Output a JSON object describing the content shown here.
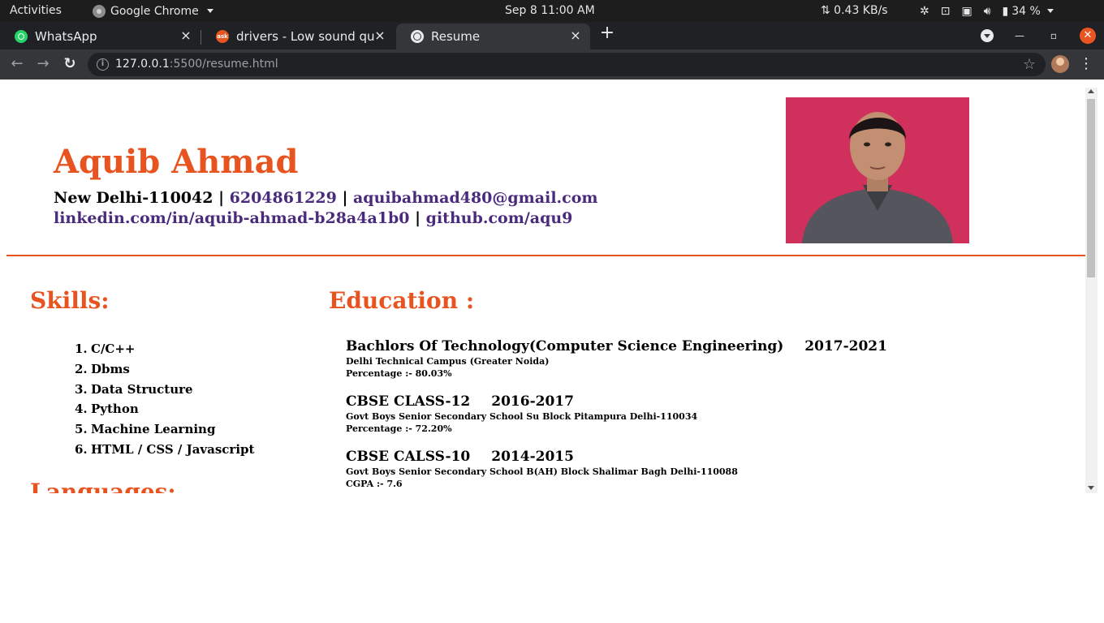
{
  "system_bar": {
    "activities": "Activities",
    "app_name": "Google Chrome",
    "clock": "Sep 8  11:00 AM",
    "net_speed": "⇅ 0.43 KB/s",
    "battery": "34 %"
  },
  "tabs": [
    {
      "title": "WhatsApp",
      "close": "×"
    },
    {
      "title": "drivers - Low sound qu",
      "close": "×"
    },
    {
      "title": "Resume",
      "close": "×"
    }
  ],
  "toolbar": {
    "url_host": "127.0.0.1",
    "url_path": ":5500/resume.html",
    "new_tab": "+"
  },
  "resume": {
    "name": "Aquib Ahmad",
    "location": "New Delhi-110042",
    "sep": "|",
    "phone": "6204861229",
    "email": "aquibahmad480@gmail.com",
    "linkedin": "linkedin.com/in/aquib-ahmad-b28a4a1b0",
    "github": "github.com/aqu9",
    "skills_heading": "Skills:",
    "skills": [
      "C/C++",
      "Dbms",
      "Data Structure",
      "Python",
      "Machine Learning",
      "HTML / CSS / Javascript"
    ],
    "education_heading": "Education :",
    "languages_heading": "Languages:",
    "education": [
      {
        "title": "Bachlors Of Technology(Computer Science Engineering)",
        "years": "2017-2021",
        "school": "Delhi Technical Campus (Greater Noida)",
        "score": "Percentage :- 80.03%"
      },
      {
        "title": "CBSE CLASS-12",
        "years": "2016-2017",
        "school": "Govt Boys Senior Secondary School Su Block Pitampura Delhi-110034",
        "score": "Percentage :- 72.20%"
      },
      {
        "title": "CBSE CALSS-10",
        "years": "2014-2015",
        "school": "Govt Boys Senior Secondary School B(AH) Block Shalimar Bagh Delhi-110088",
        "score": "CGPA :- 7.6"
      }
    ]
  },
  "colors": {
    "accent": "#e8541f",
    "link": "#4a2a7d",
    "photo_bg": "#d0305c"
  }
}
